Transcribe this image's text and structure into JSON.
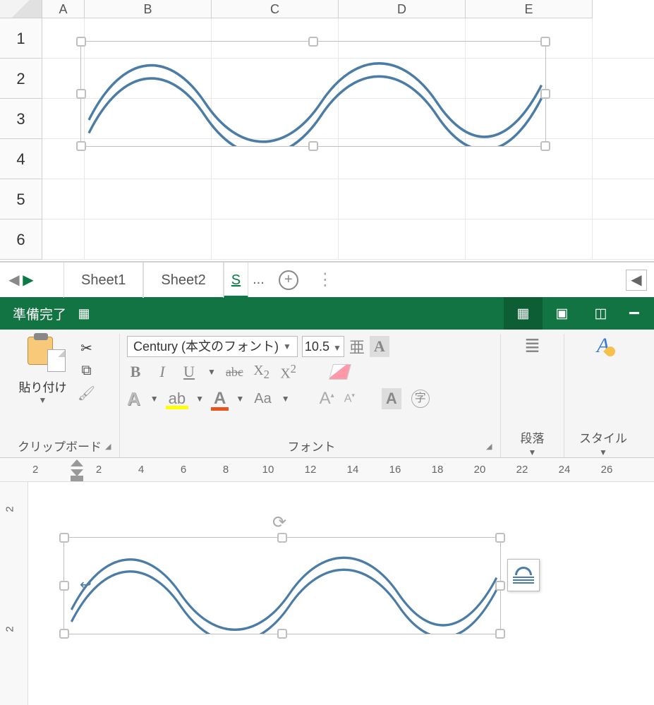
{
  "excel": {
    "columns": [
      "A",
      "B",
      "C",
      "D",
      "E"
    ],
    "rows": [
      "1",
      "2",
      "3",
      "4",
      "5",
      "6"
    ],
    "tabs": {
      "sheet1": "Sheet1",
      "sheet2": "Sheet2",
      "sheet3": "S",
      "more": "..."
    },
    "status": "準備完了"
  },
  "word": {
    "font": {
      "name": "Century (本文のフォント)",
      "size": "10.5"
    },
    "paste_label": "貼り付け",
    "group_clipboard": "クリップボード",
    "group_font": "フォント",
    "group_paragraph": "段落",
    "group_style": "スタイル",
    "ruler_indent": "2",
    "hruler_nums": [
      "2",
      "4",
      "6",
      "8",
      "10",
      "12",
      "14",
      "16",
      "18",
      "20",
      "22",
      "24",
      "26"
    ],
    "vruler_nums": [
      "2",
      "2"
    ]
  }
}
